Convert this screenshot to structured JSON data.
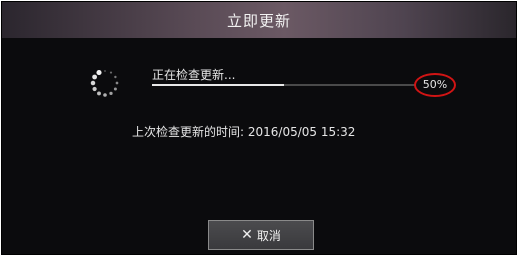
{
  "dialog": {
    "title": "立即更新"
  },
  "update": {
    "status_text": "正在检查更新...",
    "progress_fraction": 0.5,
    "percent_text": "50%",
    "last_check_text": "上次检查更新的时间: 2016/05/05 15:32"
  },
  "cancel": {
    "icon": "close-icon",
    "label": "取消"
  },
  "colors": {
    "dialog_bg": "#0b0b0d",
    "text": "#e6e6e6",
    "annotation_red": "#d11414"
  }
}
